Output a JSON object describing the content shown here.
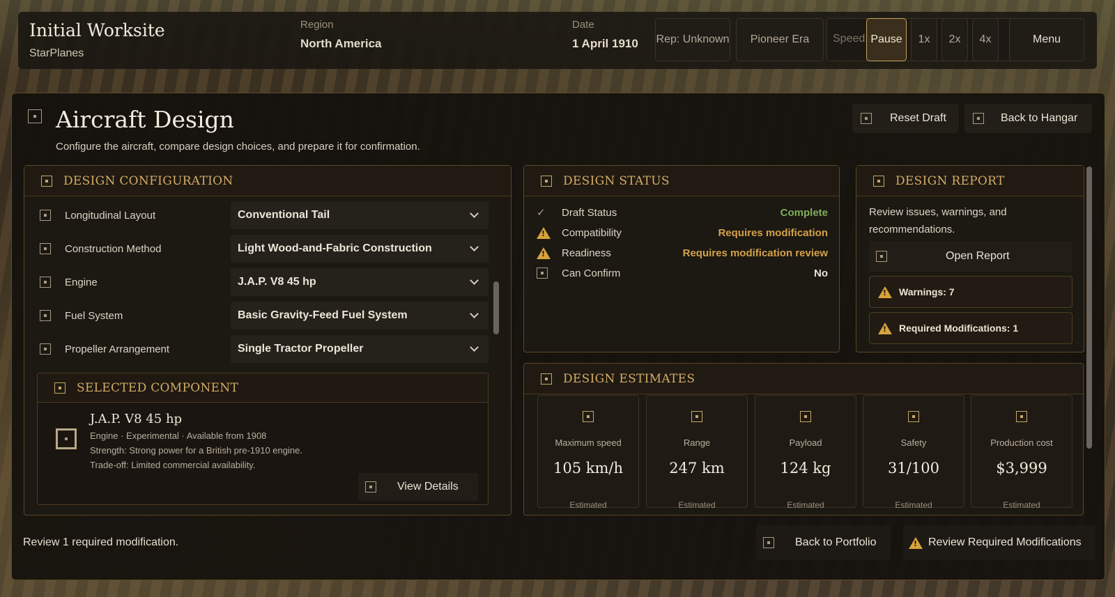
{
  "topbar": {
    "title": "Initial Worksite",
    "subtitle": "StarPlanes",
    "region_label": "Region",
    "region_value": "North America",
    "date_label": "Date",
    "date_value": "1 April 1910",
    "rep": "Rep: Unknown",
    "era": "Pioneer Era",
    "speed_label": "Speed:",
    "speed_options": [
      "Pause",
      "1x",
      "2x",
      "4x"
    ],
    "speed_selected": "Pause",
    "menu": "Menu"
  },
  "page": {
    "title": "Aircraft Design",
    "subtitle": "Configure the aircraft, compare design choices, and prepare it for confirmation.",
    "reset_label": "Reset Draft",
    "back_hangar_label": "Back to Hangar"
  },
  "config": {
    "heading": "DESIGN CONFIGURATION",
    "rows": [
      {
        "label": "Longitudinal Layout",
        "value": "Conventional Tail"
      },
      {
        "label": "Construction Method",
        "value": "Light Wood-and-Fabric Construction"
      },
      {
        "label": "Engine",
        "value": "J.A.P. V8 45 hp"
      },
      {
        "label": "Fuel System",
        "value": "Basic Gravity-Feed Fuel System"
      },
      {
        "label": "Propeller Arrangement",
        "value": "Single Tractor Propeller"
      }
    ],
    "scroll_position": 0.45
  },
  "selected_component": {
    "heading": "SELECTED COMPONENT",
    "name": "J.A.P. V8 45 hp",
    "meta": "Engine · Experimental · Available from 1908",
    "strength": "Strength: Strong power for a British pre-1910 engine.",
    "tradeoff": "Trade-off: Limited commercial availability.",
    "view_details": "View Details"
  },
  "status": {
    "heading": "DESIGN STATUS",
    "rows": [
      {
        "icon": "check-icon",
        "label": "Draft Status",
        "value": "Complete",
        "color": "#7fae5a"
      },
      {
        "icon": "warning-icon",
        "label": "Compatibility",
        "value": "Requires modification",
        "color": "#d4a24a"
      },
      {
        "icon": "warning-icon",
        "label": "Readiness",
        "value": "Requires modification review",
        "color": "#d4a24a"
      },
      {
        "icon": "square-icon",
        "label": "Can Confirm",
        "value": "No",
        "color": "#e8e2d4"
      }
    ]
  },
  "report": {
    "heading": "DESIGN REPORT",
    "description": "Review issues, warnings, and recommendations.",
    "open_label": "Open Report",
    "warnings": "Warnings: 7",
    "required_mods": "Required Modifications: 1"
  },
  "estimates": {
    "heading": "DESIGN ESTIMATES",
    "items": [
      {
        "label": "Maximum speed",
        "value": "105 km/h",
        "note": "Estimated"
      },
      {
        "label": "Range",
        "value": "247 km",
        "note": "Estimated"
      },
      {
        "label": "Payload",
        "value": "124 kg",
        "note": "Estimated"
      },
      {
        "label": "Safety",
        "value": "31/100",
        "note": "Estimated"
      },
      {
        "label": "Production cost",
        "value": "$3,999",
        "note": "Estimated"
      }
    ]
  },
  "footer": {
    "message": "Review 1 required modification.",
    "back_portfolio": "Back to Portfolio",
    "review_mods": "Review Required Modifications"
  },
  "colors": {
    "accent_gold": "#d4ac66",
    "complete_green": "#7fae5a",
    "warning_amber": "#d4a24a"
  }
}
